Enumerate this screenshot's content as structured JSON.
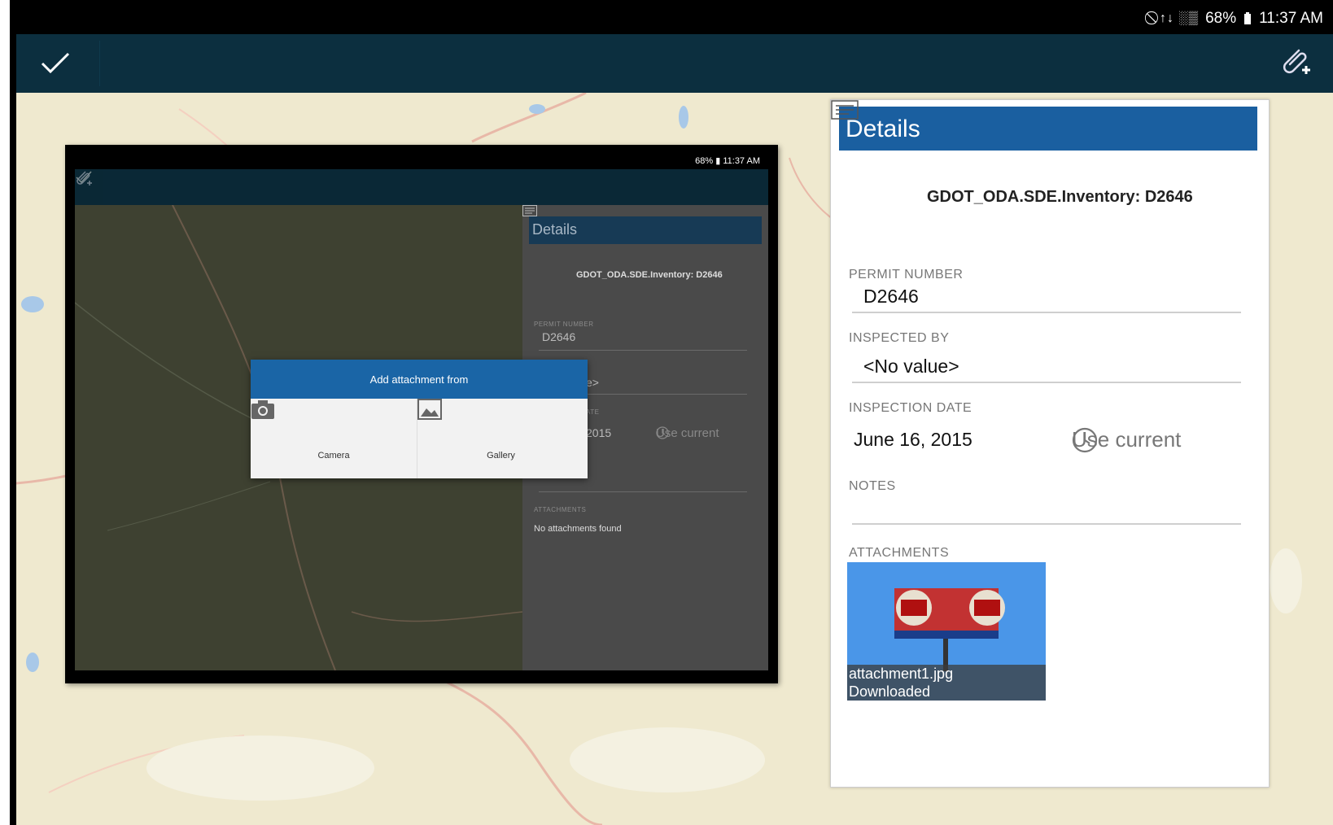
{
  "status_bar": {
    "icons": "⃠ ↑↓ ░▒",
    "battery": "68%",
    "time": "11:37 AM"
  },
  "toolbar": {
    "confirm_icon": "check-icon",
    "attach_icon": "paperclip-plus-icon"
  },
  "details": {
    "title": "Details",
    "feature_title": "GDOT_ODA.SDE.Inventory: D2646",
    "fields": {
      "permit_number": {
        "label": "PERMIT NUMBER",
        "value": "D2646"
      },
      "inspected_by": {
        "label": "INSPECTED BY",
        "value": "<No value>"
      },
      "inspection_date": {
        "label": "INSPECTION DATE",
        "value": "June 16, 2015",
        "action": "Use current"
      },
      "notes": {
        "label": "NOTES",
        "value": ""
      }
    },
    "attachments": {
      "label": "ATTACHMENTS",
      "items": [
        {
          "name": "attachment1.jpg",
          "status": "Downloaded"
        }
      ]
    }
  },
  "inset": {
    "status_text": "68% ▮ 11:37 AM",
    "panel_title": "Details",
    "feature_title": "GDOT_ODA.SDE.Inventory: D2646",
    "permit_label": "PERMIT NUMBER",
    "permit_value": "D2646",
    "partial_value": "e>",
    "partial_label": "ATE",
    "partial_date": "2015",
    "use_current": "Use current",
    "attachments_label": "ATTACHMENTS",
    "no_attachments": "No attachments found",
    "dialog": {
      "title": "Add attachment from",
      "camera": "Camera",
      "gallery": "Gallery"
    }
  },
  "colors": {
    "appbar": "#0c2f3f",
    "panel_header": "#1a5fa0",
    "dialog_header": "#1a65a6",
    "map": "#efe9cf"
  }
}
